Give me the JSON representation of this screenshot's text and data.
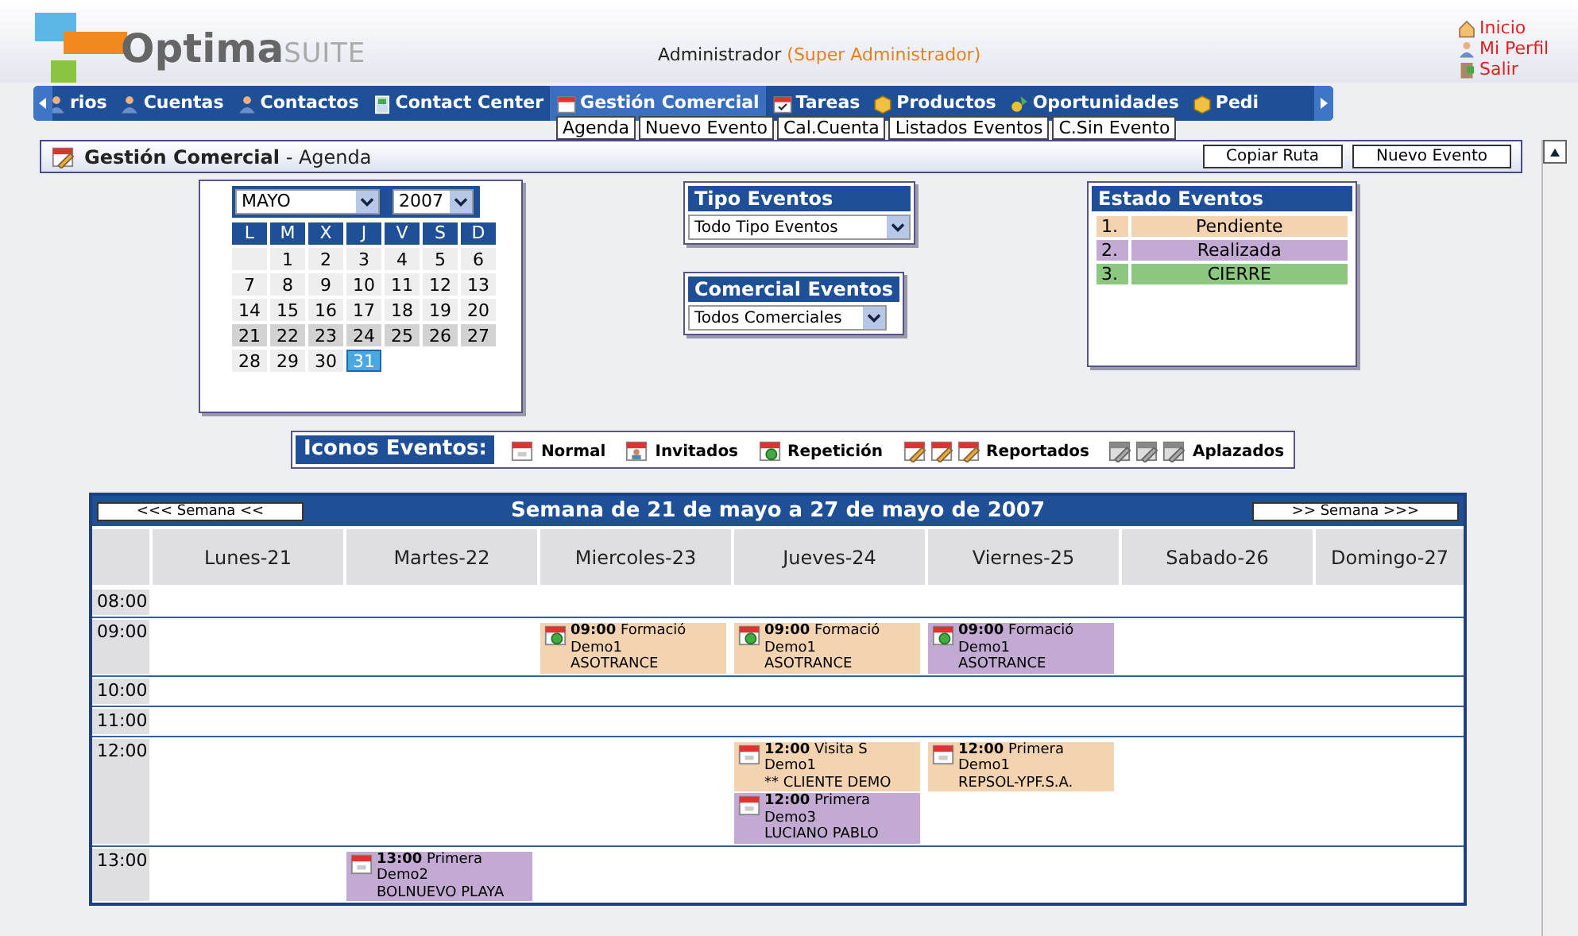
{
  "logo": {
    "name": "Optima",
    "suffix": "SUITE"
  },
  "user": {
    "name": "Administrador",
    "role": "(Super Administrador)"
  },
  "top_links": [
    {
      "label": "Inicio",
      "kind": "home"
    },
    {
      "label": "Mi Perfil",
      "kind": "profile"
    },
    {
      "label": "Salir",
      "kind": "exit"
    }
  ],
  "nav": [
    {
      "label": "rios",
      "kind": "people",
      "selected": false
    },
    {
      "label": "Cuentas",
      "kind": "people",
      "selected": false
    },
    {
      "label": "Contactos",
      "kind": "people",
      "selected": false
    },
    {
      "label": "Contact Center",
      "kind": "phone",
      "selected": false
    },
    {
      "label": "Gestión Comercial",
      "kind": "calendar",
      "selected": true
    },
    {
      "label": "Tareas",
      "kind": "task",
      "selected": false
    },
    {
      "label": "Productos",
      "kind": "box",
      "selected": false
    },
    {
      "label": "Oportunidades",
      "kind": "money",
      "selected": false
    },
    {
      "label": "Pedi",
      "kind": "box",
      "selected": false
    }
  ],
  "submenu": [
    "Agenda",
    "Nuevo Evento",
    "Cal.Cuenta",
    "Listados Eventos",
    "C.Sin Evento"
  ],
  "page_title": {
    "section": "Gestión Comercial",
    "page": "- Agenda"
  },
  "page_buttons": [
    "Copiar Ruta",
    "Nuevo Evento"
  ],
  "calendar": {
    "month": "MAYO",
    "year": "2007",
    "weekdays": [
      "L",
      "M",
      "X",
      "J",
      "V",
      "S",
      "D"
    ],
    "weeks": [
      [
        {
          "day": "1",
          "highlighted": false,
          "selected": false
        },
        {
          "day": "2",
          "highlighted": false,
          "selected": false
        },
        {
          "day": "3",
          "highlighted": false,
          "selected": false
        },
        {
          "day": "4",
          "highlighted": false,
          "selected": false
        },
        {
          "day": "5",
          "highlighted": false,
          "selected": false
        },
        {
          "day": "6",
          "highlighted": false,
          "selected": false
        }
      ],
      [
        {
          "day": "7",
          "highlighted": false,
          "selected": false
        },
        {
          "day": "8",
          "highlighted": false,
          "selected": false
        },
        {
          "day": "9",
          "highlighted": false,
          "selected": false
        },
        {
          "day": "10",
          "highlighted": false,
          "selected": false
        },
        {
          "day": "11",
          "highlighted": false,
          "selected": false
        },
        {
          "day": "12",
          "highlighted": false,
          "selected": false
        },
        {
          "day": "13",
          "highlighted": false,
          "selected": false
        }
      ],
      [
        {
          "day": "14",
          "highlighted": false,
          "selected": false
        },
        {
          "day": "15",
          "highlighted": false,
          "selected": false
        },
        {
          "day": "16",
          "highlighted": false,
          "selected": false
        },
        {
          "day": "17",
          "highlighted": false,
          "selected": false
        },
        {
          "day": "18",
          "highlighted": false,
          "selected": false
        },
        {
          "day": "19",
          "highlighted": false,
          "selected": false
        },
        {
          "day": "20",
          "highlighted": false,
          "selected": false
        }
      ],
      [
        {
          "day": "21",
          "highlighted": true,
          "selected": false
        },
        {
          "day": "22",
          "highlighted": true,
          "selected": false
        },
        {
          "day": "23",
          "highlighted": true,
          "selected": false
        },
        {
          "day": "24",
          "highlighted": true,
          "selected": false
        },
        {
          "day": "25",
          "highlighted": true,
          "selected": false
        },
        {
          "day": "26",
          "highlighted": true,
          "selected": false
        },
        {
          "day": "27",
          "highlighted": true,
          "selected": false
        }
      ],
      [
        {
          "day": "28",
          "highlighted": false,
          "selected": false
        },
        {
          "day": "29",
          "highlighted": false,
          "selected": false
        },
        {
          "day": "30",
          "highlighted": false,
          "selected": false
        },
        {
          "day": "31",
          "highlighted": false,
          "selected": true
        }
      ]
    ]
  },
  "tipo_eventos": {
    "title": "Tipo Eventos",
    "value": "Todo Tipo Eventos"
  },
  "comercial_eventos": {
    "title": "Comercial Eventos",
    "value": "Todos Comerciales"
  },
  "estado_eventos": {
    "title": "Estado Eventos",
    "items": [
      {
        "number": "1.",
        "label": "Pendiente",
        "color": "#f4d3b0"
      },
      {
        "number": "2.",
        "label": "Realizada",
        "color": "#c3aad2"
      },
      {
        "number": "3.",
        "label": "CIERRE",
        "color": "#8cc87f"
      }
    ]
  },
  "iconos_eventos": {
    "title": "Iconos Eventos:",
    "items": [
      {
        "label": "Normal",
        "kind": "normal"
      },
      {
        "label": "Invitados",
        "kind": "invitados"
      },
      {
        "label": "Repetición",
        "kind": "repeticion"
      },
      {
        "label": "Reportados",
        "kind": "reportados"
      },
      {
        "label": "Aplazados",
        "kind": "aplazados"
      }
    ]
  },
  "week": {
    "prev": "<<< Semana <<",
    "title": "Semana de 21 de mayo a 27 de mayo de 2007",
    "next": ">> Semana >>>",
    "days": [
      "Lunes-21",
      "Martes-22",
      "Miercoles-23",
      "Jueves-24",
      "Viernes-25",
      "Sabado-26",
      "Domingo-27"
    ],
    "slots": [
      {
        "time": "08:00"
      },
      {
        "time": "09:00",
        "cells": [
          {},
          {},
          {
            "events": [
              {
                "kind": "repeticion",
                "time": "09:00",
                "title": "Formació",
                "user": "Demo1",
                "client": "ASOTRANCE",
                "color": "#f4d3b0"
              }
            ]
          },
          {
            "events": [
              {
                "kind": "repeticion",
                "time": "09:00",
                "title": "Formació",
                "user": "Demo1",
                "client": "ASOTRANCE",
                "color": "#f4d3b0"
              }
            ]
          },
          {
            "events": [
              {
                "kind": "repeticion",
                "time": "09:00",
                "title": "Formació",
                "user": "Demo1",
                "client": "ASOTRANCE",
                "color": "#c3aad2"
              }
            ]
          }
        ]
      },
      {
        "time": "10:00"
      },
      {
        "time": "11:00"
      },
      {
        "time": "12:00",
        "cells": [
          {},
          {},
          {},
          {
            "events": [
              {
                "kind": "normal",
                "time": "12:00",
                "title": "Visita S",
                "user": "Demo1",
                "client": "** CLIENTE DEMO",
                "color": "#f4d3b0"
              },
              {
                "kind": "normal",
                "time": "12:00",
                "title": "Primera",
                "user": "Demo3",
                "client": "LUCIANO PABLO",
                "color": "#c3aad2"
              }
            ]
          },
          {
            "events": [
              {
                "kind": "normal",
                "time": "12:00",
                "title": "Primera",
                "user": "Demo1",
                "client": "REPSOL-YPF.S.A.",
                "color": "#f4d3b0"
              }
            ]
          }
        ]
      },
      {
        "time": "13:00",
        "cells": [
          {},
          {
            "events": [
              {
                "kind": "normal",
                "time": "13:00",
                "title": "Primera",
                "user": "Demo2",
                "client": "BOLNUEVO PLAYA",
                "color": "#c3aad2"
              }
            ]
          }
        ]
      }
    ]
  }
}
